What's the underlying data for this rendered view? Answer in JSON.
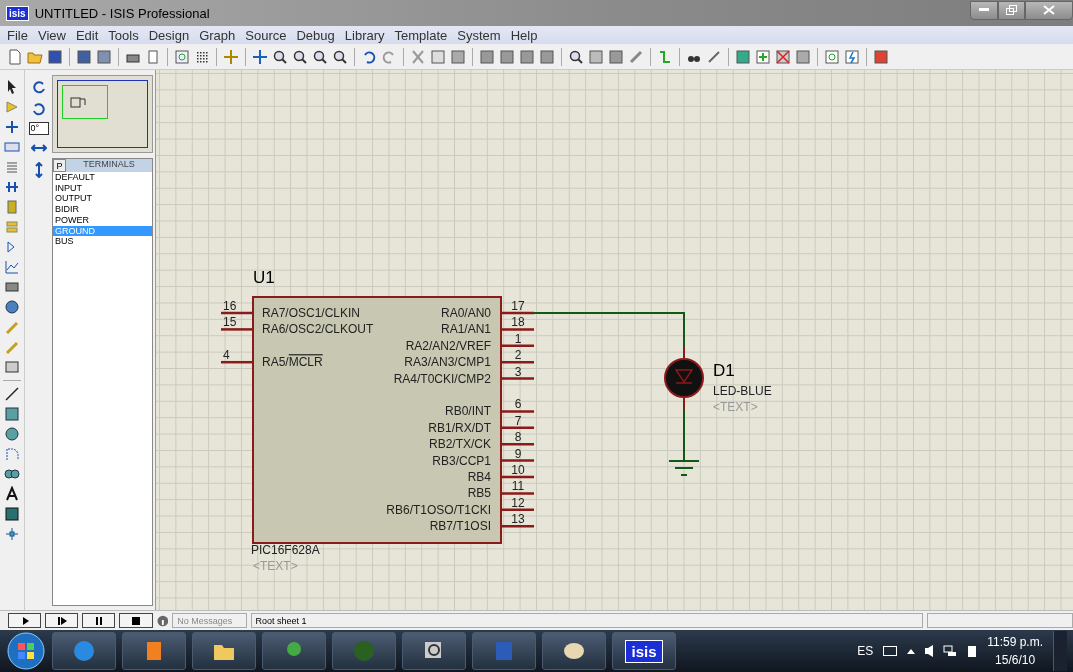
{
  "window": {
    "logo": "isis",
    "title": "UNTITLED - ISIS Professional"
  },
  "menu": [
    "File",
    "View",
    "Edit",
    "Tools",
    "Design",
    "Graph",
    "Source",
    "Debug",
    "Library",
    "Template",
    "System",
    "Help"
  ],
  "rotation": {
    "value": "0°"
  },
  "selector": {
    "button": "P",
    "title": "TERMINALS",
    "items": [
      {
        "label": "DEFAULT",
        "selected": false
      },
      {
        "label": "INPUT",
        "selected": false
      },
      {
        "label": "OUTPUT",
        "selected": false
      },
      {
        "label": "BIDIR",
        "selected": false
      },
      {
        "label": "POWER",
        "selected": false
      },
      {
        "label": "GROUND",
        "selected": true
      },
      {
        "label": "BUS",
        "selected": false
      }
    ]
  },
  "schematic": {
    "chip": {
      "ref": "U1",
      "part": "PIC16F628A",
      "text": "<TEXT>",
      "left_pins": [
        {
          "number": "16",
          "name": "RA7/OSC1/CLKIN"
        },
        {
          "number": "15",
          "name": "RA6/OSC2/CLKOUT"
        },
        {
          "number": "4",
          "name": "RA5/",
          "overlined": "MCLR"
        }
      ],
      "right_pins": [
        {
          "number": "17",
          "name": "RA0/AN0"
        },
        {
          "number": "18",
          "name": "RA1/AN1"
        },
        {
          "number": "1",
          "name": "RA2/AN2/VREF"
        },
        {
          "number": "2",
          "name": "RA3/AN3/CMP1"
        },
        {
          "number": "3",
          "name": "RA4/T0CKI/CMP2"
        },
        {
          "number": "6",
          "name": "RB0/INT"
        },
        {
          "number": "7",
          "name": "RB1/RX/DT"
        },
        {
          "number": "8",
          "name": "RB2/TX/CK"
        },
        {
          "number": "9",
          "name": "RB3/CCP1"
        },
        {
          "number": "10",
          "name": "RB4"
        },
        {
          "number": "11",
          "name": "RB5"
        },
        {
          "number": "12",
          "name": "RB6/T1OSO/T1CKI"
        },
        {
          "number": "13",
          "name": "RB7/T1OSI"
        }
      ]
    },
    "led": {
      "ref": "D1",
      "value": "LED-BLUE",
      "text": "<TEXT>"
    }
  },
  "status_bar": {
    "message": "No Messages",
    "sheet": "Root sheet 1"
  },
  "taskbar": {
    "app_button": "isis",
    "language": "ES",
    "time": "11:59 p.m.",
    "date": "15/6/10"
  }
}
